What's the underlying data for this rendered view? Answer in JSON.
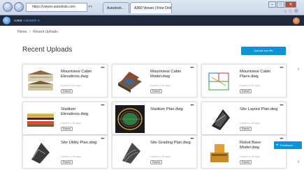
{
  "browser": {
    "address": "https://viewer.autodesk.com",
    "tabs": [
      "Autodesk...",
      "A360 Viewer | Free Online R..."
    ],
    "controls": {
      "minimize": "–",
      "maximize": "□",
      "close": "✕"
    }
  },
  "app": {
    "brand_main": "A360",
    "brand_accent": "VIEWER"
  },
  "breadcrumb": {
    "home": "Home",
    "separator": ">",
    "current": "Recent Uploads"
  },
  "main": {
    "title": "Recent Uploads",
    "upload_button": "Upload new file",
    "cards": [
      {
        "name": "Mountview Cabin Elevations.dwg",
        "expires": "Expires in 30 days",
        "badge": "Extend",
        "thumb": "elevation"
      },
      {
        "name": "Mountview Cabin Model.dwg",
        "expires": "Expires in 30 days",
        "badge": "Extend",
        "thumb": "model"
      },
      {
        "name": "Mountview Cabin Plans.dwg",
        "expires": "Expires in 30 days",
        "badge": "Extend",
        "thumb": "plan"
      },
      {
        "name": "Stadium Elevations.dwg",
        "expires": "Expires in 30 days",
        "badge": "Extend",
        "thumb": "stadium-elev"
      },
      {
        "name": "Stadium Plan.dwg",
        "expires": "",
        "badge": "",
        "thumb": "stadium-plan"
      },
      {
        "name": "Site Layout Plan.dwg",
        "expires": "Expires in 30 days",
        "badge": "Extend",
        "thumb": "site-layout"
      },
      {
        "name": "Site Utility Plan.dwg",
        "expires": "Expires in 30 days",
        "badge": "Extend",
        "thumb": "site-utility"
      },
      {
        "name": "Site Grading Plan.dwg",
        "expires": "Expires in 30 days",
        "badge": "Extend",
        "thumb": "site-grading"
      },
      {
        "name": "Robot Base Model.dwg",
        "expires": "Expires in 30 days",
        "badge": "Extend",
        "thumb": "robot"
      }
    ]
  },
  "feedback": {
    "label": "Feedback",
    "icon": "megaphone-icon"
  },
  "colors": {
    "accent": "#0696d7",
    "header": "#1e2a3b"
  }
}
